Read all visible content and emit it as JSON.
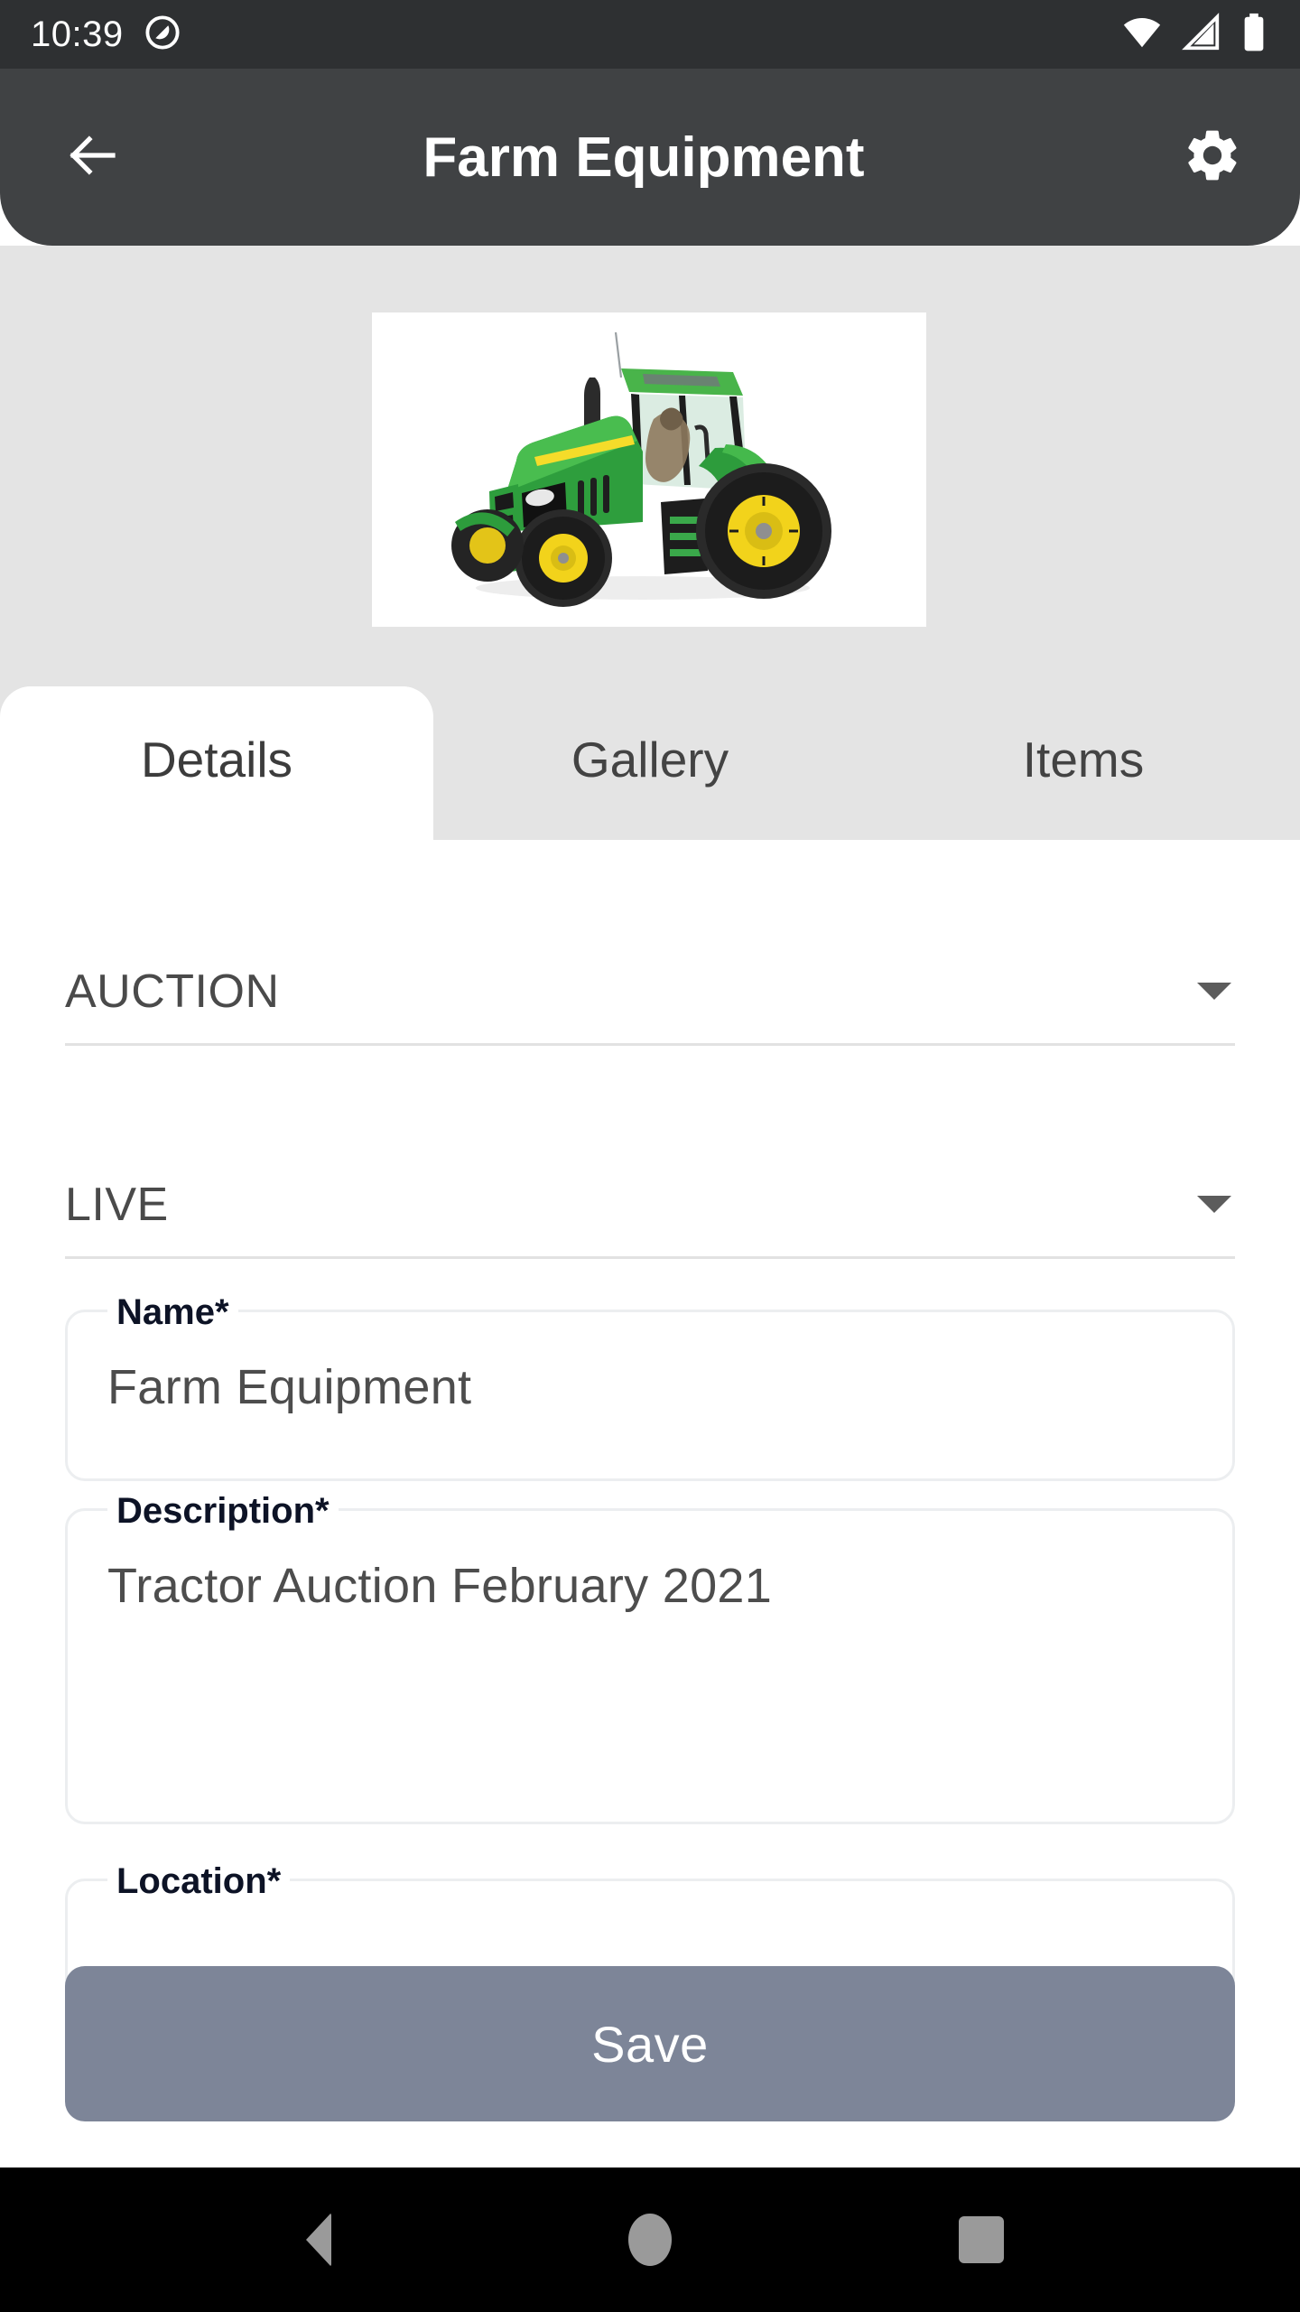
{
  "status_bar": {
    "time": "10:39",
    "icons": [
      "do-not-disturb-icon",
      "wifi-icon",
      "cellular-no-sim-icon",
      "battery-full-icon"
    ],
    "background": "#2e3032"
  },
  "appbar": {
    "back_icon": "arrow-left-icon",
    "title": "Farm Equipment",
    "settings_icon": "gear-icon",
    "background": "#404244"
  },
  "hero": {
    "image_alt": "green-tractor",
    "background": "#e4e4e4"
  },
  "tabs": [
    {
      "label": "Details",
      "active": true
    },
    {
      "label": "Gallery",
      "active": false
    },
    {
      "label": "Items",
      "active": false
    }
  ],
  "form": {
    "auction_type": {
      "value": "AUCTION",
      "dropdown_icon": "chevron-down-icon"
    },
    "auction_mode": {
      "value": "LIVE",
      "dropdown_icon": "chevron-down-icon"
    },
    "name": {
      "label": "Name*",
      "value": "Farm Equipment"
    },
    "description": {
      "label": "Description*",
      "value": "Tractor Auction February 2021"
    },
    "location": {
      "label": "Location*",
      "value": ""
    }
  },
  "save_button": {
    "label": "Save",
    "color": "#7d8598"
  },
  "navbar": {
    "back": "nav-back-icon",
    "home": "nav-home-icon",
    "recents": "nav-recents-icon"
  }
}
